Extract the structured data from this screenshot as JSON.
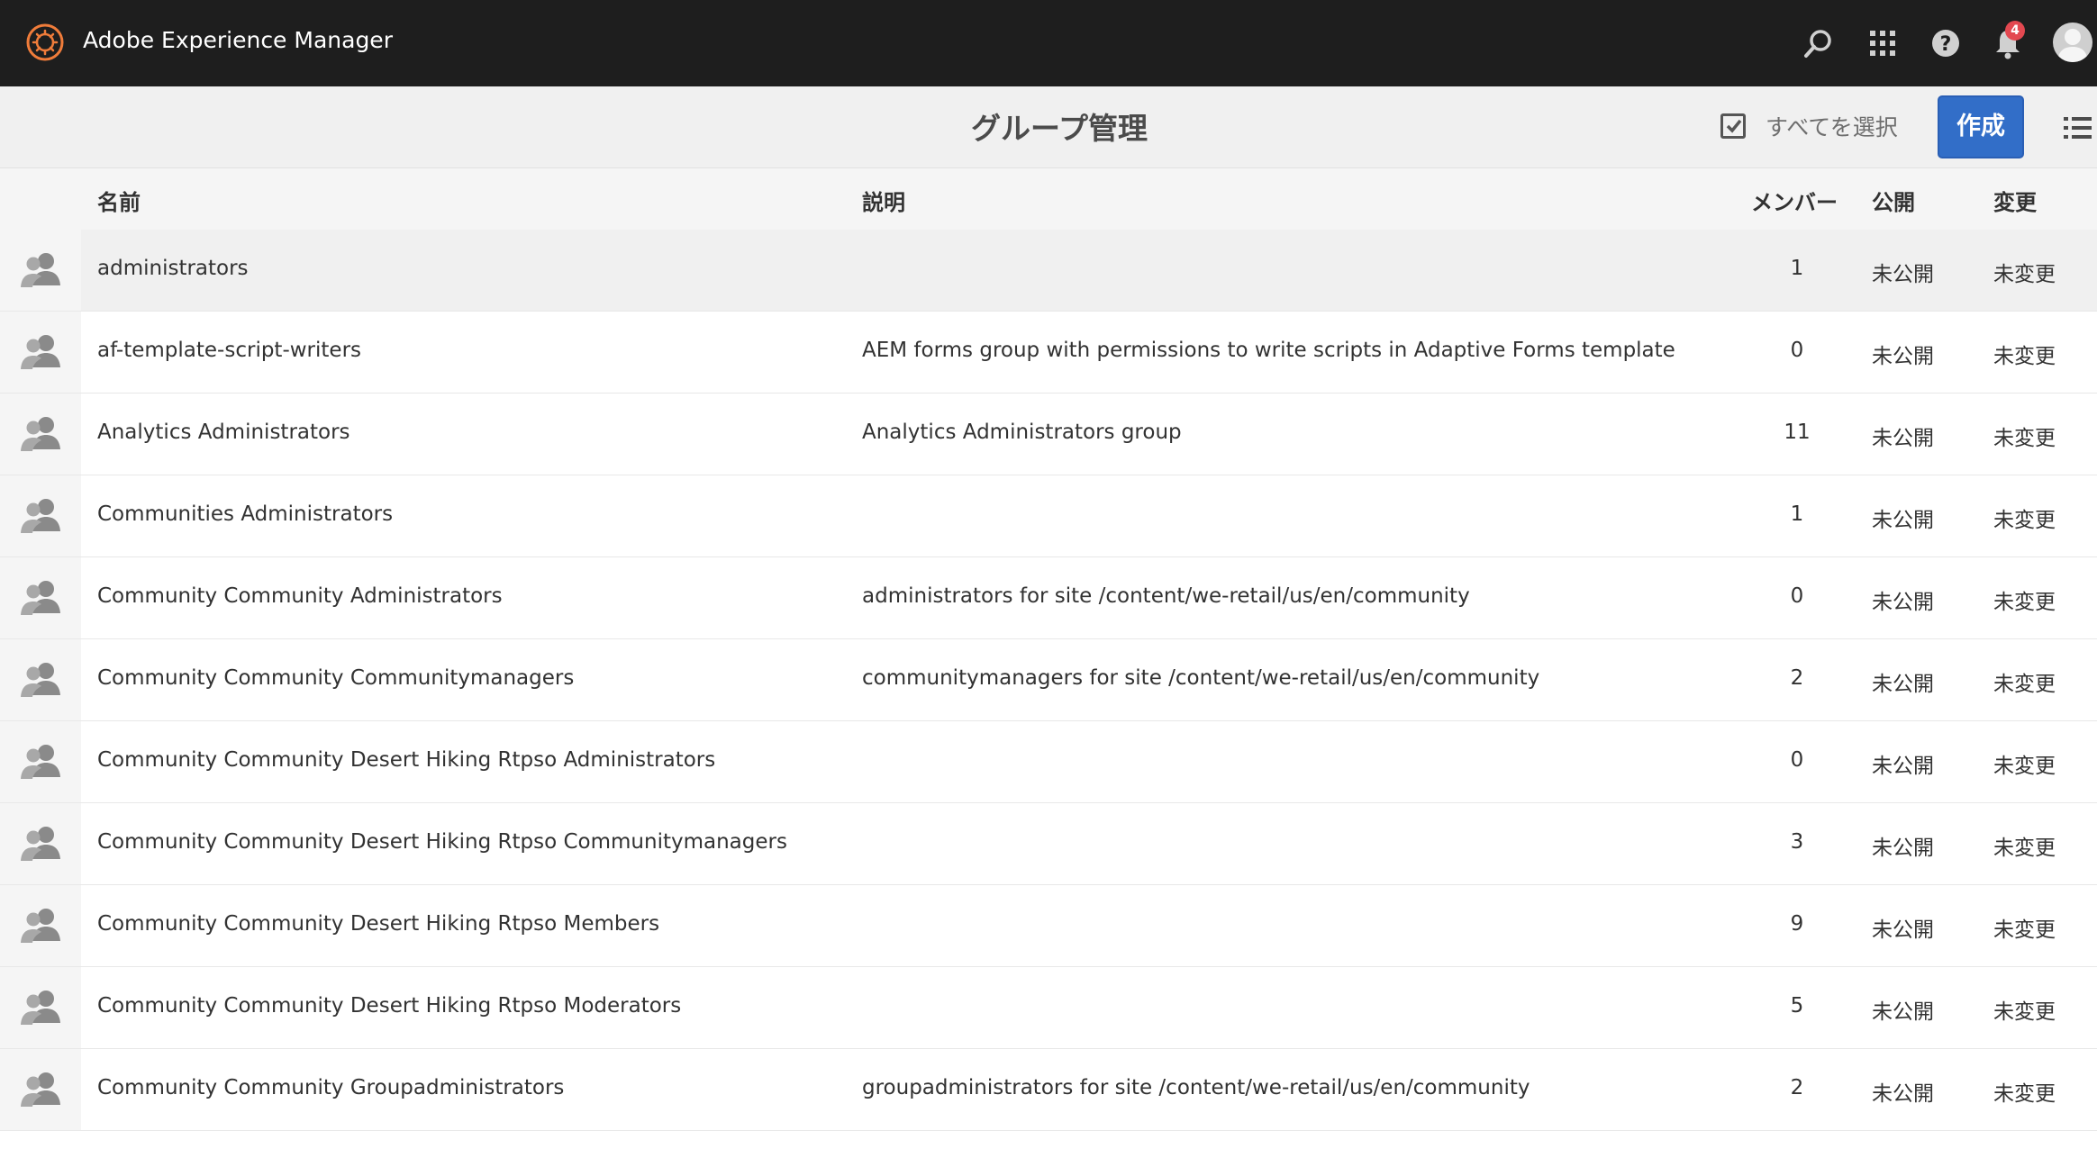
{
  "shell": {
    "app_title": "Adobe Experience Manager",
    "notification_count": "4",
    "icons": [
      "adobe-experience-manager-logo",
      "search-icon",
      "apps-grid-icon",
      "help-icon",
      "bell-icon",
      "user-avatar"
    ]
  },
  "actionbar": {
    "page_title": "グループ管理",
    "select_all_label": "すべてを選択",
    "create_label": "作成",
    "view_switch_icon": "list-view-icon"
  },
  "table": {
    "headers": {
      "name": "名前",
      "description": "説明",
      "members": "メンバー",
      "published": "公開",
      "modified": "変更"
    },
    "rows": [
      {
        "name": "administrators",
        "description": "",
        "members": "1",
        "published": "未公開",
        "modified": "未変更"
      },
      {
        "name": "af-template-script-writers",
        "description": "AEM forms group with permissions to write scripts in Adaptive Forms template",
        "members": "0",
        "published": "未公開",
        "modified": "未変更"
      },
      {
        "name": "Analytics Administrators",
        "description": "Analytics Administrators group",
        "members": "11",
        "published": "未公開",
        "modified": "未変更"
      },
      {
        "name": "Communities Administrators",
        "description": "",
        "members": "1",
        "published": "未公開",
        "modified": "未変更"
      },
      {
        "name": "Community Community Administrators",
        "description": "administrators for site /content/we-retail/us/en/community",
        "members": "0",
        "published": "未公開",
        "modified": "未変更"
      },
      {
        "name": "Community Community Communitymanagers",
        "description": "communitymanagers for site /content/we-retail/us/en/community",
        "members": "2",
        "published": "未公開",
        "modified": "未変更"
      },
      {
        "name": "Community Community Desert Hiking Rtpso Administrators",
        "description": "",
        "members": "0",
        "published": "未公開",
        "modified": "未変更"
      },
      {
        "name": "Community Community Desert Hiking Rtpso Communitymanagers",
        "description": "",
        "members": "3",
        "published": "未公開",
        "modified": "未変更"
      },
      {
        "name": "Community Community Desert Hiking Rtpso Members",
        "description": "",
        "members": "9",
        "published": "未公開",
        "modified": "未変更"
      },
      {
        "name": "Community Community Desert Hiking Rtpso Moderators",
        "description": "",
        "members": "5",
        "published": "未公開",
        "modified": "未変更"
      },
      {
        "name": "Community Community Groupadministrators",
        "description": "groupadministrators for site /content/we-retail/us/en/community",
        "members": "2",
        "published": "未公開",
        "modified": "未変更"
      }
    ]
  },
  "colors": {
    "shell_bg": "#1e1e1e",
    "accent_blue": "#326ec8",
    "badge_red": "#e34850",
    "actionbar_bg": "#f0f0f0"
  }
}
